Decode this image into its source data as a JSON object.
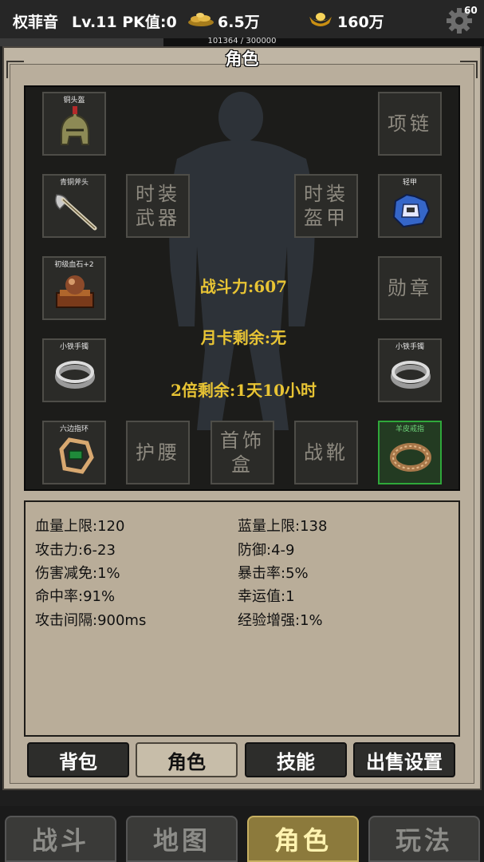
{
  "topbar": {
    "player_name": "权菲音",
    "level_pk": "Lv.11 PK值:0",
    "gold": "6.5万",
    "ingot": "160万",
    "fps": "60",
    "exp_text": "101364 / 300000",
    "exp_progress": 0.338
  },
  "panel": {
    "title": "角色"
  },
  "equipment": {
    "helmet": "铜头盔",
    "weapon": "青铜斧头",
    "gem": "初级血石+2",
    "bracelet_left": "小铁手镯",
    "ring_left": "六边指环",
    "necklace": "项链",
    "armor": "轻甲",
    "medal": "勋章",
    "bracelet_right": "小铁手镯",
    "ring_right": "羊皮戒指",
    "fashion_weapon": "时装\n武器",
    "fashion_armor": "时装\n盔甲",
    "belt": "护腰",
    "jewelry_box": "首饰\n盒",
    "boots": "战靴"
  },
  "summary": {
    "combat_power": "战斗力:607",
    "month_card": "月卡剩余:无",
    "double_remaining": "2倍剩余:1天10小时"
  },
  "attributes": {
    "hp_max": "血量上限:120",
    "mp_max": "蓝量上限:138",
    "attack": "攻击力:6-23",
    "defense": "防御:4-9",
    "damage_reduction": "伤害减免:1%",
    "crit_rate": "暴击率:5%",
    "hit_rate": "命中率:91%",
    "luck": "幸运值:1",
    "attack_interval": "攻击间隔:900ms",
    "exp_bonus": "经验增强:1%"
  },
  "subtabs": [
    "背包",
    "角色",
    "技能",
    "出售设置"
  ],
  "subtab_active": "角色",
  "nav": [
    "战斗",
    "地图",
    "角色",
    "玩法"
  ],
  "nav_active": "角色",
  "colors": {
    "accent_yellow": "#e8c434",
    "selected_green": "#2fa83a"
  }
}
